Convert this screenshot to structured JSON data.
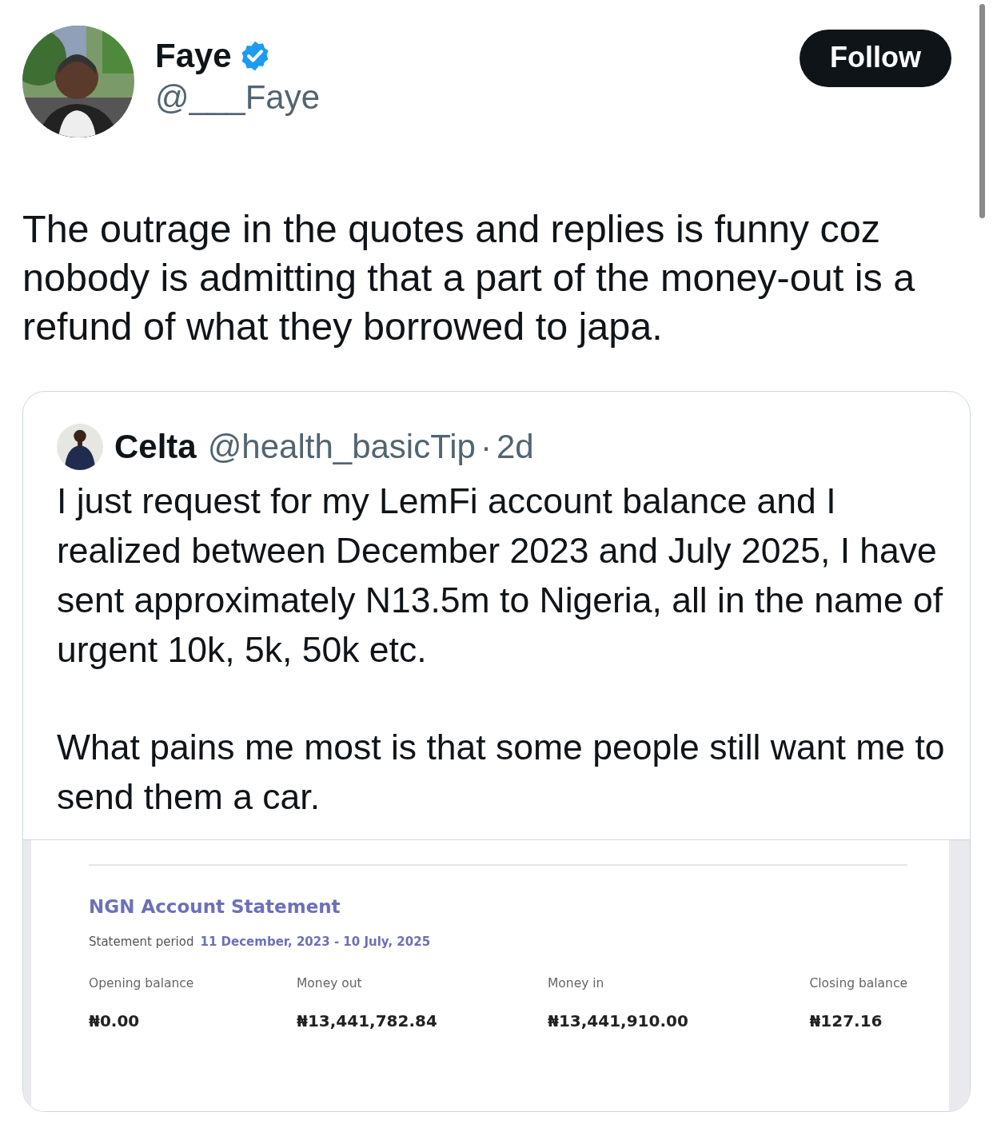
{
  "author": {
    "name": "Faye",
    "verified": true,
    "handle": "@___Faye"
  },
  "follow_button": "Follow",
  "text": "The outrage in the quotes and replies is funny coz nobody is admitting that a part of the money-out is a refund of what they borrowed to japa.",
  "quoted_tweet": {
    "author": {
      "name": "Celta",
      "handle": "@health_basicTip"
    },
    "separator": "·",
    "time": "2d",
    "paragraphs": [
      "I just request for my LemFi account balance and I realized between December 2023 and July 2025, I have sent approximately N13.5m to Nigeria, all in the name of urgent 10k, 5k, 50k etc.",
      "What pains me most is that some people still want me to send them a car."
    ],
    "statement": {
      "title": "NGN Account Statement",
      "period_label": "Statement period",
      "period": "11 December, 2023 - 10 July, 2025",
      "figures": [
        {
          "label": "Opening balance",
          "amount": "₦0.00"
        },
        {
          "label": "Money out",
          "amount": "₦13,441,782.84"
        },
        {
          "label": "Money in",
          "amount": "₦13,441,910.00"
        },
        {
          "label": "Closing balance",
          "amount": "₦127.16"
        }
      ]
    }
  }
}
